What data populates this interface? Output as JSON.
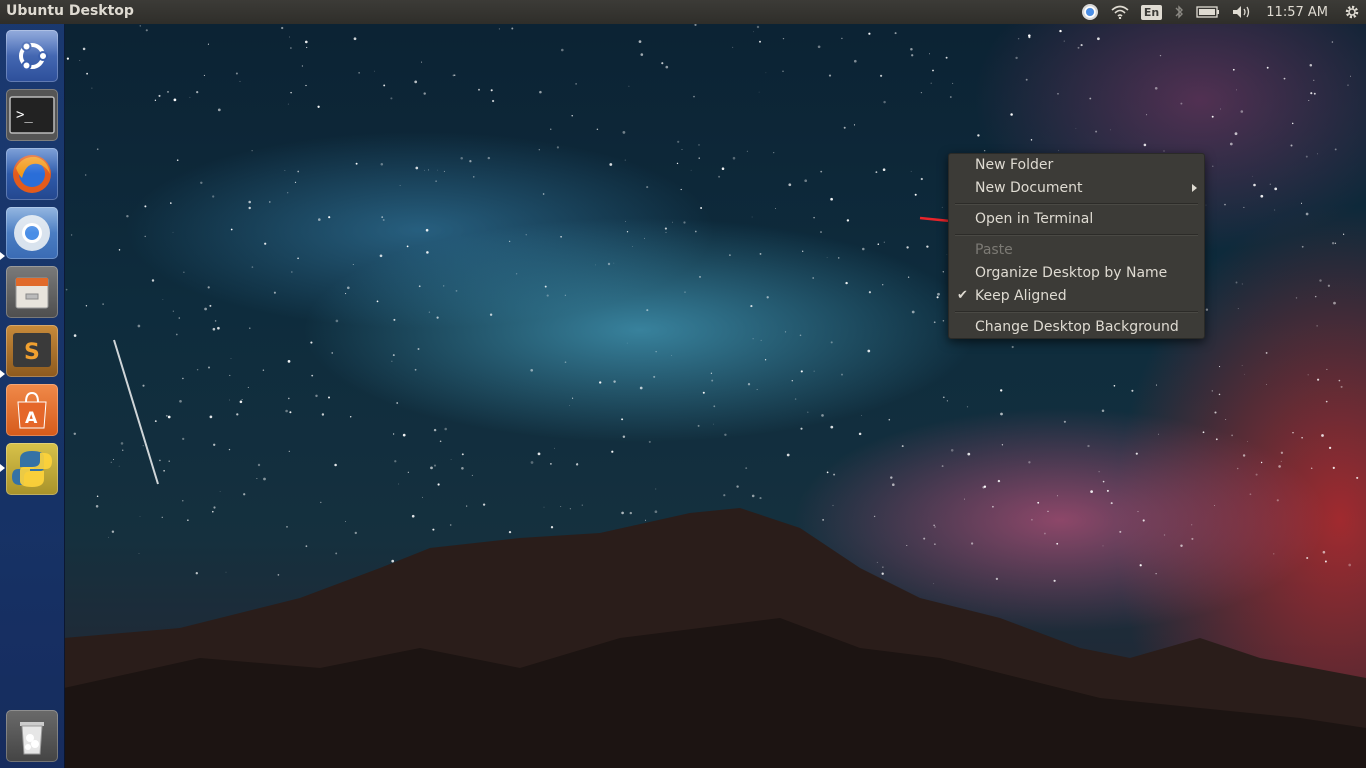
{
  "panel": {
    "title": "Ubuntu Desktop",
    "keyboard_layout": "En",
    "clock": "11:57 AM",
    "icons": [
      "chrome-indicator-icon",
      "wifi-icon",
      "keyboard-layout",
      "bluetooth-icon",
      "battery-icon",
      "volume-icon",
      "clock",
      "settings-gear-icon"
    ]
  },
  "launcher": {
    "items": [
      {
        "name": "ubuntu-dash",
        "icon": "ubuntu-logo-icon"
      },
      {
        "name": "terminal",
        "icon": "terminal-icon",
        "prompt": ">_"
      },
      {
        "name": "firefox",
        "icon": "firefox-icon"
      },
      {
        "name": "chromium",
        "icon": "chromium-icon"
      },
      {
        "name": "files",
        "icon": "file-cabinet-icon"
      },
      {
        "name": "sublime-text",
        "icon": "sublime-text-icon",
        "glyph": "S"
      },
      {
        "name": "software-center",
        "icon": "shopping-bag-icon",
        "glyph": "A"
      },
      {
        "name": "python",
        "icon": "python-icon"
      },
      {
        "name": "trash",
        "icon": "trash-icon"
      }
    ]
  },
  "context_menu": {
    "new_folder": "New Folder",
    "new_document": "New Document",
    "open_in_terminal": "Open in Terminal",
    "paste": "Paste",
    "organize_by_name": "Organize Desktop by Name",
    "keep_aligned": "Keep Aligned",
    "keep_aligned_checked": true,
    "change_background": "Change Desktop Background",
    "check_glyph": "✔"
  },
  "colors": {
    "panel_bg": "#3c3b37",
    "menu_bg": "#3c3b37",
    "menu_text": "#dfdbd2",
    "disabled_text": "#7c7a74",
    "annotation_arrow": "#e8242a",
    "launcher_bg": "#1c3c78"
  }
}
